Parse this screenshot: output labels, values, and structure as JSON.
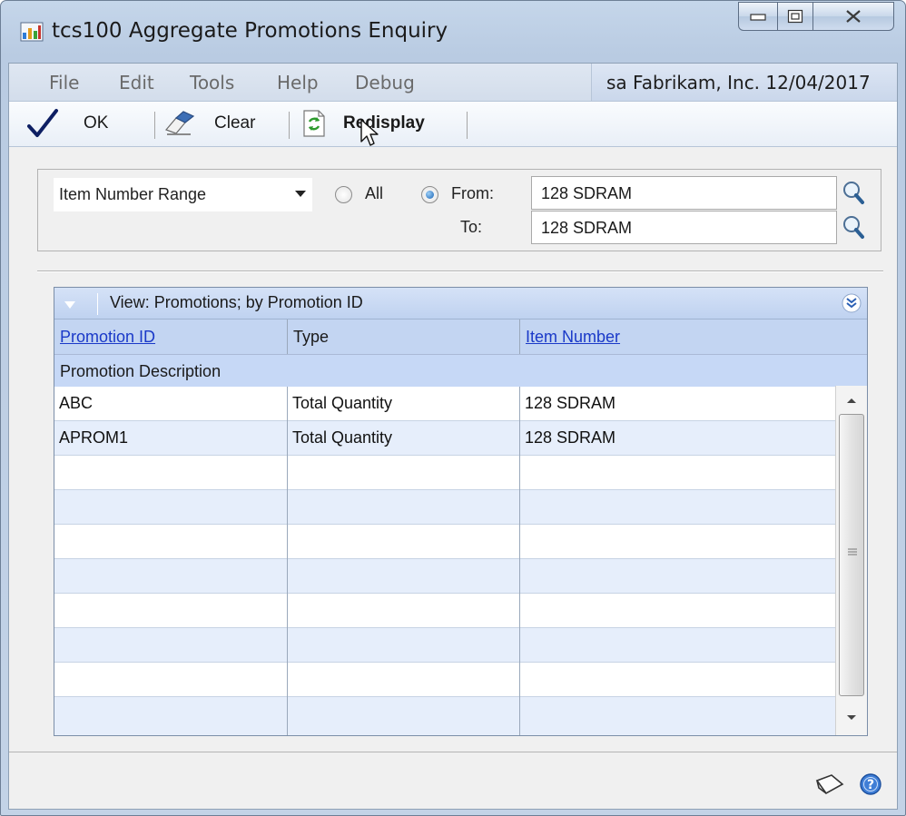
{
  "window": {
    "title": "tcs100 Aggregate Promotions Enquiry"
  },
  "menu": {
    "items": [
      "File",
      "Edit",
      "Tools",
      "Help",
      "Debug"
    ]
  },
  "user_info": {
    "text": "sa  Fabrikam, Inc.  12/04/2017"
  },
  "toolbar": {
    "ok_label": "OK",
    "clear_label": "Clear",
    "redisplay_label": "Redisplay"
  },
  "range": {
    "type_selected": "Item Number Range",
    "all_label": "All",
    "from_label": "From:",
    "to_label": "To:",
    "selected_option": "From",
    "from_value": "128 SDRAM",
    "to_value": "128 SDRAM"
  },
  "grid": {
    "view_label": "View: Promotions; by Promotion ID",
    "columns": [
      "Promotion ID",
      "Type",
      "Item Number"
    ],
    "second_header": "Promotion Description",
    "rows": [
      [
        "ABC",
        "Total Quantity",
        "128 SDRAM"
      ],
      [
        "APROM1",
        "Total Quantity",
        "128 SDRAM"
      ]
    ]
  },
  "colors": {
    "header_blue": "#c3d5f2",
    "link_blue": "#1a39c8",
    "alt_row": "#e6eefb"
  }
}
